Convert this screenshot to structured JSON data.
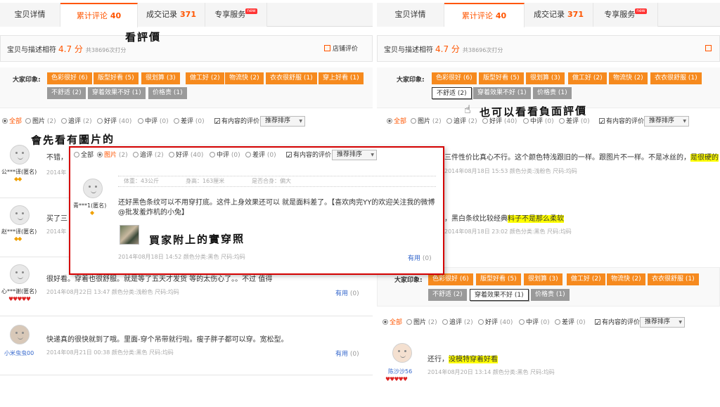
{
  "tabs": [
    {
      "label": "宝贝详情",
      "num": ""
    },
    {
      "label": "累计评论",
      "num": "40"
    },
    {
      "label": "成交记录",
      "num": "371"
    },
    {
      "label": "专享服务",
      "num": "",
      "badge": "new"
    }
  ],
  "rating": {
    "label": "宝贝与描述相符",
    "score": "4.7 分",
    "count": "共38696次打分",
    "shop_link": "店铺评价"
  },
  "impressions": {
    "label": "大家印象:",
    "positive": [
      "色彩很好 (6)",
      "版型好看 (5)",
      "很划算 (3)",
      "做工好 (2)",
      "物流快 (2)",
      "衣衣很舒服 (1)",
      "穿上好看 (1)"
    ],
    "negative": [
      "不舒适 (2)",
      "穿着效果不好 (1)",
      "价格贵 (1)"
    ]
  },
  "filters": {
    "all": "全部",
    "items": [
      {
        "label": "图片",
        "count": "(2)"
      },
      {
        "label": "追评",
        "count": "(2)"
      },
      {
        "label": "好评",
        "count": "(40)"
      },
      {
        "label": "中评",
        "count": "(0)"
      },
      {
        "label": "差评",
        "count": "(0)"
      }
    ],
    "has_content": "有内容的评价",
    "sort": "推荐排序"
  },
  "left_reviews": [
    {
      "user": "公***译(匿名)",
      "text": "不错，",
      "meta": "2014年",
      "useful": ""
    },
    {
      "user": "赵***译(匿名)",
      "text": "买了三",
      "meta": "2014年",
      "useful": ""
    },
    {
      "user": "心***谢(匿名)",
      "text": "很好看。穿着也很舒服。就是等了五天才发货 等的太伤心了。。不过 值得",
      "meta": "2014年08月22日 13:47    颜色分类:浅粉色    尺码:均码",
      "useful": "有用",
      "useful_count": "(0)"
    },
    {
      "user": "小米虫虫00",
      "text": "快递真的很快就到了哦。里面-穿个吊带就行啦。瘦子胖子都可以穿。宽松型。",
      "meta": "2014年08月21日 00:38    颜色分类:黑色    尺码:均码",
      "useful": "有用",
      "useful_count": "(0)"
    }
  ],
  "popup": {
    "user": "青***1(匿名)",
    "info": {
      "weight": "体重：43公斤",
      "height": "身高：163厘米",
      "fit": "是否合身：偏大"
    },
    "text": "还好黑色条纹可以不用穿打底。这件上身效果还可以 就是面料差了。【喜欢肉完YY的欢迎关注我的微博@批发羞炸机的小兔】",
    "meta": "2014年08月18日 14:52    颜色分类:黑色    尺码:均码",
    "useful": "有用",
    "useful_count": "(0)"
  },
  "right_reviews": [
    {
      "text_pre": "三件性价比真心不行。这个颜色特浅跟旧的一样。跟图片不一样。不是冰丝的，",
      "text_hl": "是很硬的",
      "meta": "2014年08月18日 15:53    颜色分类:浅粉色    尺码:均码"
    },
    {
      "text_pre": "，黑白条纹比较经典",
      "text_hl": "料子不是那么柔软",
      "meta": "2014年08月18日 23:02    颜色分类:黑色    尺码:均码"
    },
    {
      "user": "陈沙沙56",
      "text_pre": "还行，",
      "text_hl": "没模特穿着好看",
      "meta": "2014年08月20日 13:14    颜色分类:黑色    尺码:均码"
    }
  ],
  "annotations": {
    "read_reviews": "看評價",
    "negative": "也可以看看負面評價",
    "pictures_first": "會先看有圖片的",
    "buyer_photo": "買家附上的實穿照"
  }
}
